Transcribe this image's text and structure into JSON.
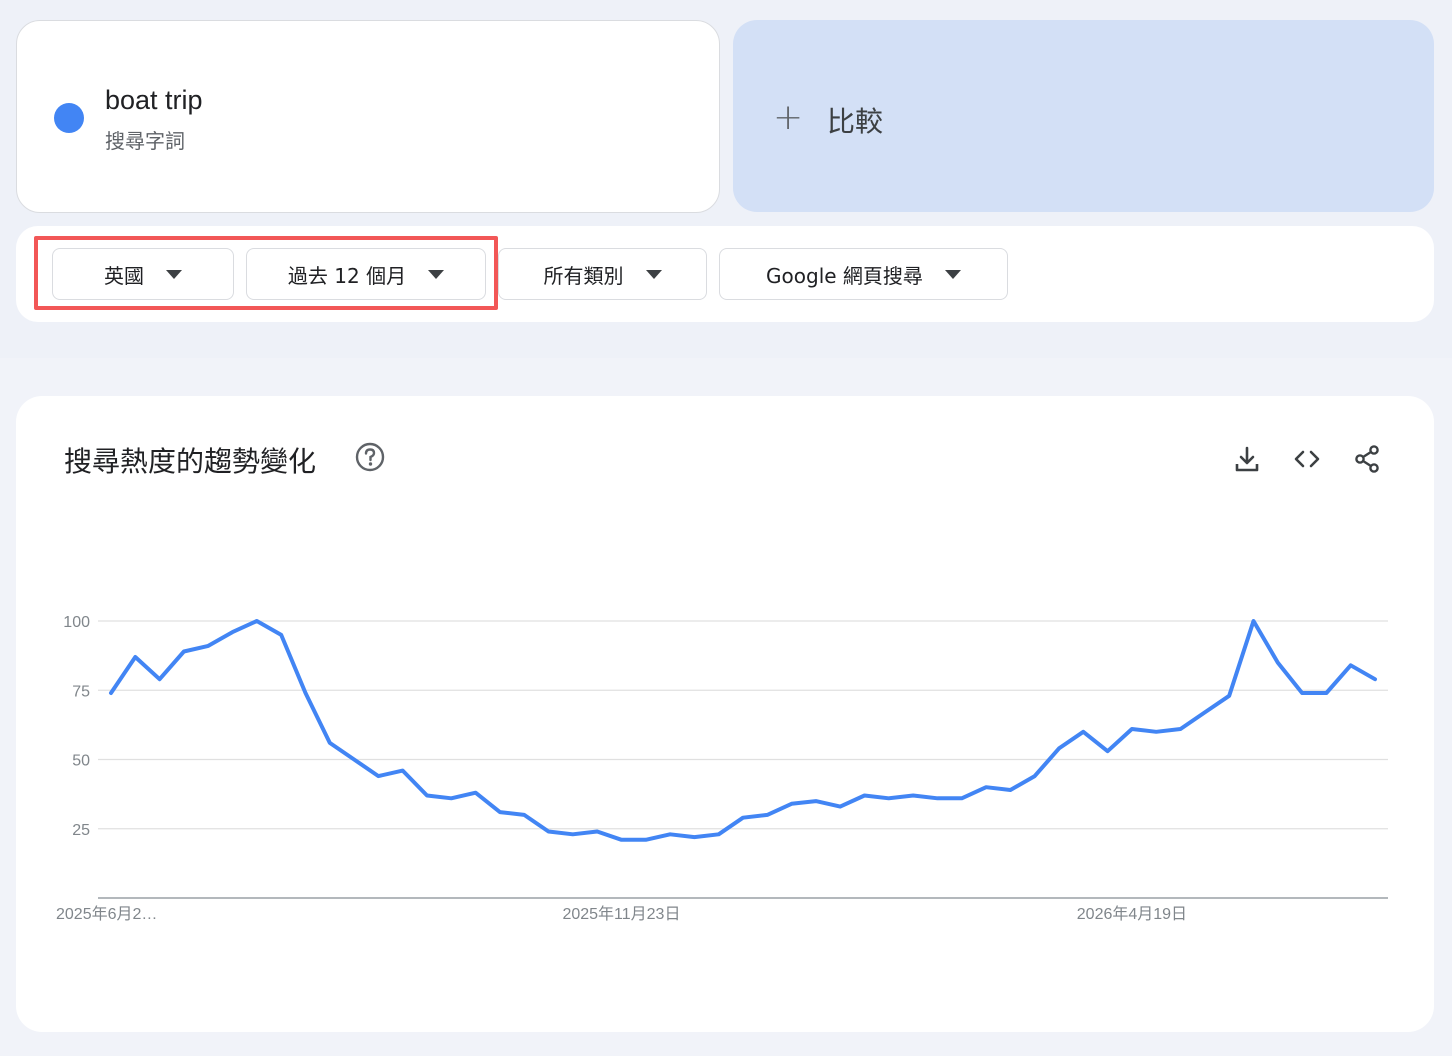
{
  "term": {
    "name": "boat trip",
    "type_label": "搜尋字詞",
    "color": "#4285f4"
  },
  "compare": {
    "plus_symbol": "+",
    "label": "比較"
  },
  "filters": {
    "region": "英國",
    "time_range": "過去 12 個月",
    "category": "所有類別",
    "source": "Google 網頁搜尋",
    "highlight_color": "#f25757"
  },
  "chart_card": {
    "title": "搜尋熱度的趨勢變化",
    "icons": [
      "help-icon",
      "download-icon",
      "embed-icon",
      "share-icon"
    ]
  },
  "chart_data": {
    "type": "line",
    "title": "",
    "xlabel": "",
    "ylabel": "",
    "ylim": [
      0,
      100
    ],
    "y_ticks": [
      "25",
      "50",
      "75",
      "100"
    ],
    "x_tick_labels": [
      "2025年6月2…",
      "2025年11月23日",
      "2026年4月19日"
    ],
    "x_tick_indices": [
      0,
      21,
      42
    ],
    "grid": true,
    "series": [
      {
        "color": "#4285f4",
        "values": [
          74,
          87,
          79,
          89,
          91,
          96,
          100,
          95,
          74,
          56,
          50,
          44,
          46,
          37,
          36,
          38,
          31,
          30,
          24,
          23,
          24,
          21,
          21,
          23,
          22,
          23,
          29,
          30,
          34,
          35,
          33,
          37,
          36,
          37,
          36,
          36,
          40,
          39,
          44,
          54,
          60,
          53,
          61,
          60,
          61,
          67,
          73,
          100,
          85,
          74,
          74,
          84,
          79
        ]
      }
    ]
  }
}
